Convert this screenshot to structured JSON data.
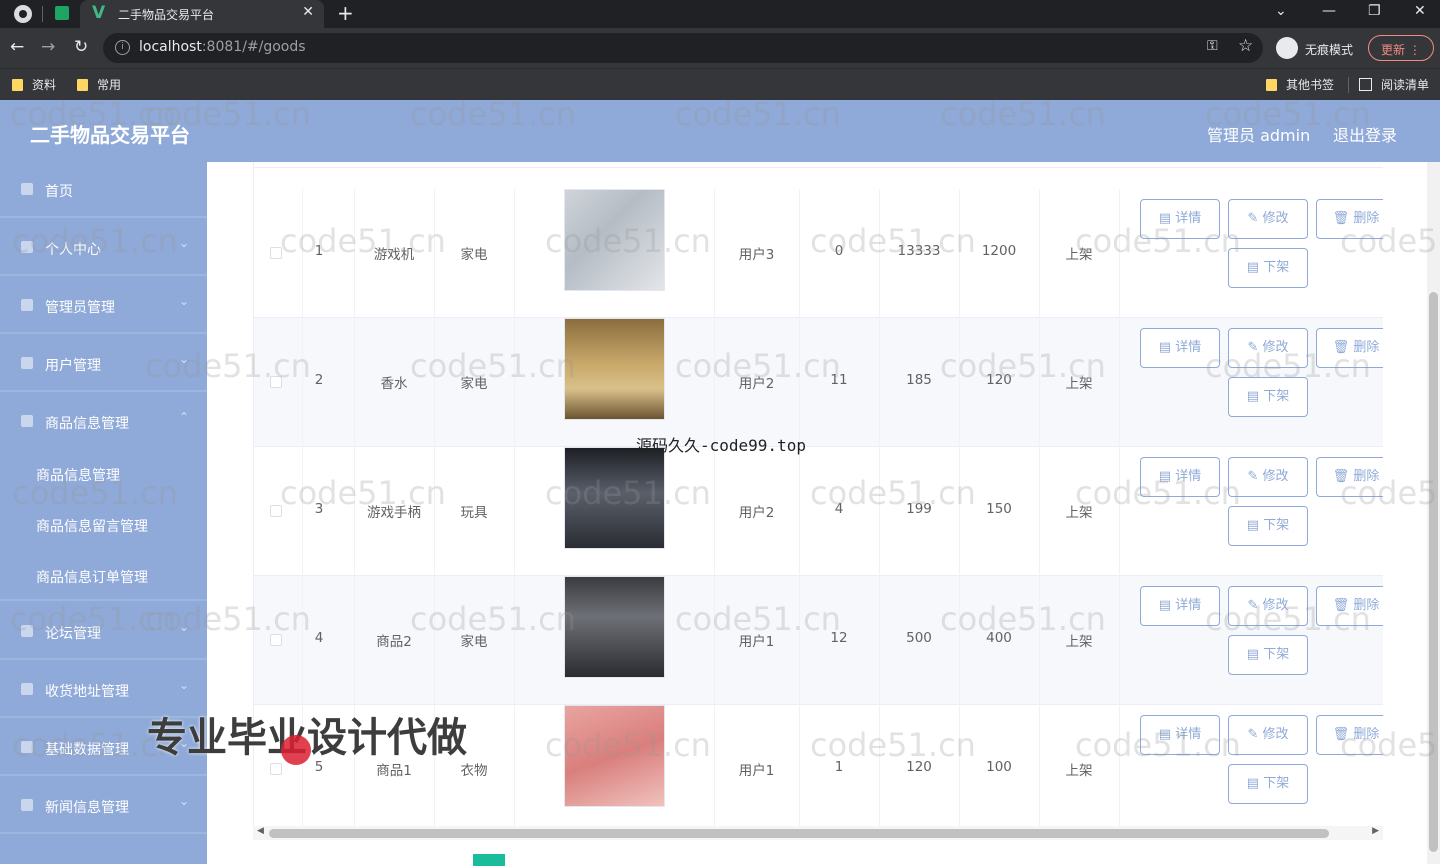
{
  "browser": {
    "tab_title": "二手物品交易平台",
    "url_host": "localhost",
    "url_rest": ":8081/#/goods",
    "incognito_label": "无痕模式",
    "update_label": "更新",
    "bookmarks": [
      "资料",
      "常用"
    ],
    "other_bookmarks": "其他书签",
    "reading_list": "阅读清单"
  },
  "header": {
    "title": "二手物品交易平台",
    "admin_label": "管理员 admin",
    "logout": "退出登录"
  },
  "sidebar": {
    "items": [
      {
        "label": "首页"
      },
      {
        "label": "个人中心"
      },
      {
        "label": "管理员管理"
      },
      {
        "label": "用户管理"
      },
      {
        "label": "商品信息管理"
      },
      {
        "label": "论坛管理"
      },
      {
        "label": "收货地址管理"
      },
      {
        "label": "基础数据管理"
      },
      {
        "label": "新闻信息管理"
      }
    ],
    "sub_items": [
      {
        "label": "商品信息管理"
      },
      {
        "label": "商品信息留言管理"
      },
      {
        "label": "商品信息订单管理"
      }
    ]
  },
  "table": {
    "rows": [
      {
        "index": "1",
        "name": "游戏机",
        "type": "家电",
        "user": "用户3",
        "c5": "0",
        "c6": "13333",
        "c7": "1200",
        "status": "上架"
      },
      {
        "index": "2",
        "name": "香水",
        "type": "家电",
        "user": "用户2",
        "c5": "11",
        "c6": "185",
        "c7": "120",
        "status": "上架"
      },
      {
        "index": "3",
        "name": "游戏手柄",
        "type": "玩具",
        "user": "用户2",
        "c5": "4",
        "c6": "199",
        "c7": "150",
        "status": "上架"
      },
      {
        "index": "4",
        "name": "商品2",
        "type": "家电",
        "user": "用户1",
        "c5": "12",
        "c6": "500",
        "c7": "400",
        "status": "上架"
      },
      {
        "index": "5",
        "name": "商品1",
        "type": "衣物",
        "user": "用户1",
        "c5": "1",
        "c6": "120",
        "c7": "100",
        "status": "上架"
      }
    ],
    "actions": {
      "detail": "详情",
      "edit": "修改",
      "delete": "删除",
      "offshelf": "下架"
    }
  },
  "overlays": {
    "source_text": "源码久久-code99.top",
    "promo_text": "专业毕业设计代做",
    "watermark": "code51.cn"
  },
  "colors": {
    "primary": "#8faad8",
    "header_bg": "#8faad8",
    "pager_active": "#1abc9c"
  }
}
